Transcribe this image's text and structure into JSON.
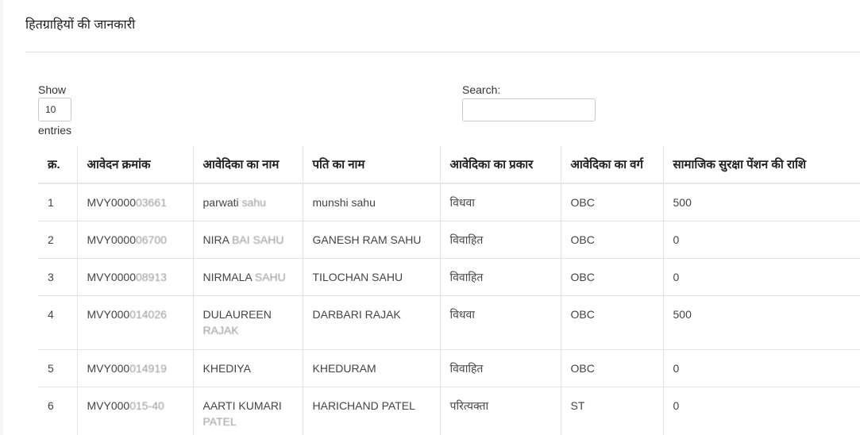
{
  "panel": {
    "title": "हितग्राहियों की जानकारी"
  },
  "controls": {
    "show_label": "Show",
    "page_length": "10",
    "entries_label": "entries",
    "search_label": "Search:",
    "search_value": ""
  },
  "table": {
    "columns": [
      "क्र.",
      "आवेदन क्रमांक",
      "आवेदिका का नाम",
      "पति का नाम",
      "आवेदिका का प्रकार",
      "आवेदिका का वर्ग",
      "सामाजिक सुरक्षा पेंशन की राशि"
    ],
    "rows": [
      {
        "sno": "1",
        "app_prefix": "MVY0000",
        "app_masked": "03661",
        "name": "parwati",
        "name_masked": "sahu",
        "husband": "munshi sahu",
        "type": "विधवा",
        "category": "OBC",
        "amount": "500"
      },
      {
        "sno": "2",
        "app_prefix": "MVY0000",
        "app_masked": "06700",
        "name": "NIRA",
        "name_masked": "BAI SAHU",
        "husband": "GANESH RAM SAHU",
        "type": "विवाहित",
        "category": "OBC",
        "amount": "0"
      },
      {
        "sno": "3",
        "app_prefix": "MVY0000",
        "app_masked": "08913",
        "name": "NIRMALA",
        "name_masked": "SAHU",
        "husband": "TILOCHAN SAHU",
        "type": "विवाहित",
        "category": "OBC",
        "amount": "0"
      },
      {
        "sno": "4",
        "app_prefix": "MVY000",
        "app_masked": "014026",
        "name": "DULAUREEN",
        "name_masked": "RAJAK",
        "husband": "DARBARI RAJAK",
        "type": "विधवा",
        "category": "OBC",
        "amount": "500"
      },
      {
        "sno": "5",
        "app_prefix": "MVY000",
        "app_masked": "014919",
        "name": "KHEDIYA",
        "name_masked": "",
        "husband": "KHEDURAM",
        "type": "विवाहित",
        "category": "OBC",
        "amount": "0"
      },
      {
        "sno": "6",
        "app_prefix": "MVY000",
        "app_masked": "015-40",
        "name": "AARTI KUMARI",
        "name_masked": "PATEL",
        "husband": "HARICHAND PATEL",
        "type": "परित्यक्ता",
        "category": "ST",
        "amount": "0"
      }
    ]
  }
}
